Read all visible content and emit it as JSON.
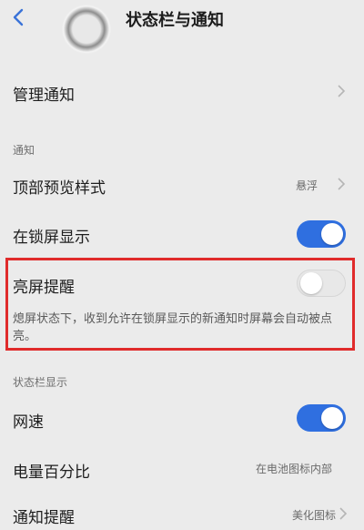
{
  "header": {
    "title": "状态栏与通知",
    "back_icon": "back-arrow-icon"
  },
  "manage": {
    "label": "管理通知"
  },
  "notify_section": {
    "label": "通知"
  },
  "top_preview": {
    "label": "顶部预览样式",
    "value": "悬浮"
  },
  "lockscreen": {
    "label": "在锁屏显示",
    "state": "on"
  },
  "screen_wake": {
    "label": "亮屏提醒",
    "state": "off",
    "description": "熄屏状态下，收到允许在锁屏显示的新通知时屏幕会自动被点亮。"
  },
  "statusbar_section": {
    "label": "状态栏显示"
  },
  "net_speed": {
    "label": "网速",
    "state": "on"
  },
  "battery": {
    "label": "电量百分比",
    "value": "在电池图标内部"
  },
  "notify_reminder": {
    "label": "通知提醒",
    "value": "美化图标"
  },
  "colors": {
    "accent": "#2f6fe0",
    "highlight": "#e02b2b",
    "background": "#ebebeb"
  }
}
